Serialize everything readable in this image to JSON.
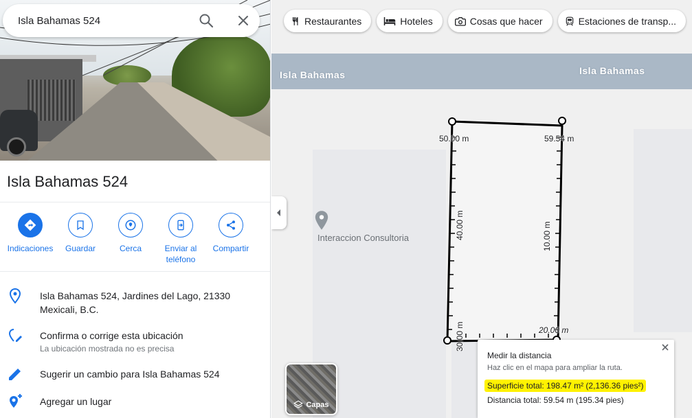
{
  "search": {
    "value": "Isla Bahamas 524"
  },
  "place": {
    "title": "Isla Bahamas 524",
    "actions": [
      {
        "label": "Indicaciones"
      },
      {
        "label": "Guardar"
      },
      {
        "label": "Cerca"
      },
      {
        "label": "Enviar al teléfono"
      },
      {
        "label": "Compartir"
      }
    ],
    "address": "Isla Bahamas 524, Jardines del Lago, 21330 Mexicali, B.C.",
    "confirm": "Confirma o corrige esta ubicación",
    "confirm_sub": "La ubicación mostrada no es precisa",
    "suggest": "Sugerir un cambio para Isla Bahamas 524",
    "add_place": "Agregar un lugar"
  },
  "map": {
    "chips": [
      "Restaurantes",
      "Hoteles",
      "Cosas que hacer",
      "Estaciones de transp..."
    ],
    "street_label_left": "Isla Bahamas",
    "street_label_right": "Isla Bahamas",
    "poi": "Interaccion Consultoria",
    "layers_label": "Capas",
    "dimensions": {
      "top_left": "50.00 m",
      "top_right": "59.54 m",
      "left": "40.00 m",
      "right": "10.00 m",
      "bottom_left": "30.00 m",
      "bottom_right": "20.00 m"
    },
    "measure": {
      "title": "Medir la distancia",
      "hint": "Haz clic en el mapa para ampliar la ruta.",
      "area": "Superficie total: 198.47 m² (2,136.36 pies²)",
      "distance": "Distancia total: 59.54 m (195.34 pies)"
    }
  },
  "colors": {
    "accent": "#1a73e8",
    "highlight": "#fff200",
    "street": "#aab8c6"
  }
}
